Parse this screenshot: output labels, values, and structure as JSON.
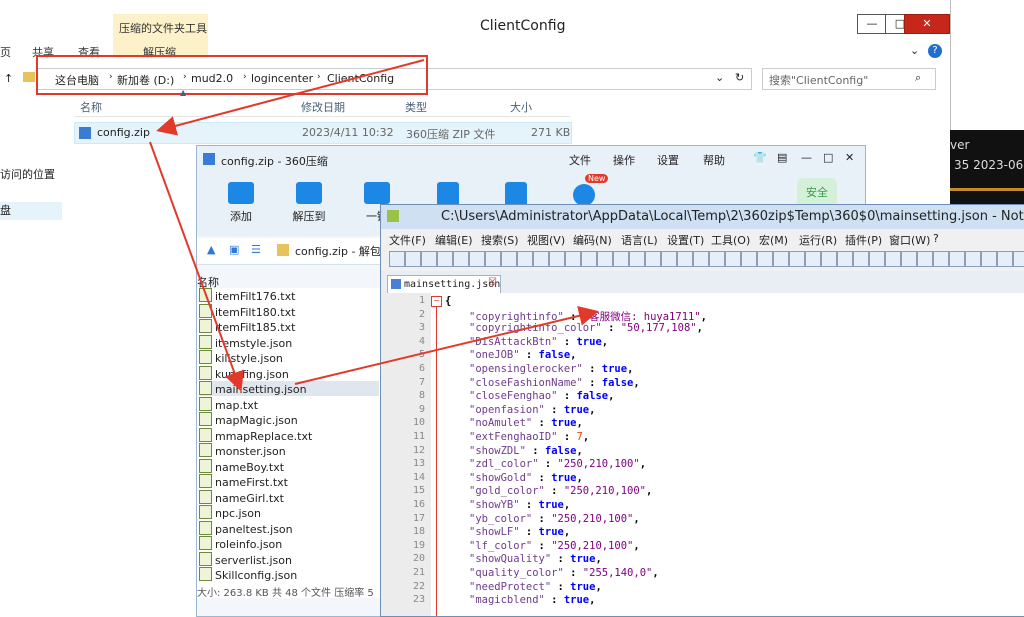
{
  "explorer": {
    "title": "ClientConfig",
    "ribbon_context_tab": "压缩的文件夹工具",
    "ribbon_tabs": [
      "页",
      "共享",
      "查看",
      "解压缩"
    ],
    "breadcrumb": [
      "这台电脑",
      "新加卷 (D:)",
      "mud2.0",
      "logincenter",
      "ClientConfig"
    ],
    "search_placeholder": "搜索\"ClientConfig\"",
    "columns": [
      "名称",
      "修改日期",
      "类型",
      "大小"
    ],
    "file": {
      "name": "config.zip",
      "date": "2023/4/11 10:32",
      "type": "360压缩 ZIP 文件",
      "size": "271 KB"
    },
    "nav_items": [
      "访问的位置",
      "盘"
    ]
  },
  "zip": {
    "title": "config.zip - 360压缩",
    "menu": [
      "文件",
      "操作",
      "设置",
      "帮助"
    ],
    "tools": [
      "添加",
      "解压到",
      "一键"
    ],
    "badge": "New",
    "security": "安全",
    "path": "config.zip - 解包",
    "list_header": "名称",
    "files": [
      "itemFilt176.txt",
      "itemFilt180.txt",
      "itemFilt185.txt",
      "itemstyle.json",
      "killstyle.json",
      "kungfing.json",
      "mainsetting.json",
      "map.txt",
      "mapMagic.json",
      "mmapReplace.txt",
      "monster.json",
      "nameBoy.txt",
      "nameFirst.txt",
      "nameGirl.txt",
      "npc.json",
      "paneltest.json",
      "roleinfo.json",
      "serverlist.json",
      "Skillconfig.json"
    ],
    "status": "大小: 263.8 KB 共 48 个文件 压缩率 5"
  },
  "notepad": {
    "title": "C:\\Users\\Administrator\\AppData\\Local\\Temp\\2\\360zip$Temp\\360$0\\mainsetting.json - Notep",
    "menu": [
      "文件(F)",
      "编辑(E)",
      "搜索(S)",
      "视图(V)",
      "编码(N)",
      "语言(L)",
      "设置(T)",
      "工具(O)",
      "宏(M)",
      "运行(R)",
      "插件(P)",
      "窗口(W)",
      "?"
    ],
    "tab": "mainsetting.json",
    "lines": [
      {
        "n": "1",
        "parts": [
          [
            "p",
            "{"
          ]
        ]
      },
      {
        "n": "2",
        "parts": [
          [
            "k",
            "\"copyrightinfo\""
          ],
          [
            "p",
            " : "
          ],
          [
            "s",
            "\"客服微信: huya1711\""
          ],
          [
            "p",
            ","
          ]
        ]
      },
      {
        "n": "3",
        "parts": [
          [
            "k",
            "\"copyrightinfo_color\""
          ],
          [
            "p",
            " : "
          ],
          [
            "s",
            "\"50,177,108\""
          ],
          [
            "p",
            ","
          ]
        ]
      },
      {
        "n": "4",
        "parts": [
          [
            "k",
            "\"DisAttackBtn\""
          ],
          [
            "p",
            " : "
          ],
          [
            "bt",
            "true"
          ],
          [
            "p",
            ","
          ]
        ]
      },
      {
        "n": "5",
        "parts": [
          [
            "k",
            "\"oneJOB\""
          ],
          [
            "p",
            " : "
          ],
          [
            "bt",
            "false"
          ],
          [
            "p",
            ","
          ]
        ]
      },
      {
        "n": "6",
        "parts": [
          [
            "k",
            "\"opensinglerocker\""
          ],
          [
            "p",
            " : "
          ],
          [
            "bt",
            "true"
          ],
          [
            "p",
            ","
          ]
        ]
      },
      {
        "n": "7",
        "parts": [
          [
            "k",
            "\"closeFashionName\""
          ],
          [
            "p",
            " : "
          ],
          [
            "bt",
            "false"
          ],
          [
            "p",
            ","
          ]
        ]
      },
      {
        "n": "8",
        "parts": [
          [
            "k",
            "\"closeFenghao\""
          ],
          [
            "p",
            " : "
          ],
          [
            "bt",
            "false"
          ],
          [
            "p",
            ","
          ]
        ]
      },
      {
        "n": "9",
        "parts": [
          [
            "k",
            "\"openfasion\""
          ],
          [
            "p",
            " : "
          ],
          [
            "bt",
            "true"
          ],
          [
            "p",
            ","
          ]
        ]
      },
      {
        "n": "10",
        "parts": [
          [
            "k",
            "\"noAmulet\""
          ],
          [
            "p",
            " : "
          ],
          [
            "bt",
            "true"
          ],
          [
            "p",
            ","
          ]
        ]
      },
      {
        "n": "11",
        "parts": [
          [
            "k",
            "\"extFenghaoID\""
          ],
          [
            "p",
            " : "
          ],
          [
            "n",
            "7"
          ],
          [
            "p",
            ","
          ]
        ]
      },
      {
        "n": "12",
        "parts": [
          [
            "k",
            "\"showZDL\""
          ],
          [
            "p",
            " : "
          ],
          [
            "bt",
            "false"
          ],
          [
            "p",
            ","
          ]
        ]
      },
      {
        "n": "13",
        "parts": [
          [
            "k",
            "\"zdl_color\""
          ],
          [
            "p",
            " : "
          ],
          [
            "s",
            "\"250,210,100\""
          ],
          [
            "p",
            ","
          ]
        ]
      },
      {
        "n": "14",
        "parts": [
          [
            "k",
            "\"showGold\""
          ],
          [
            "p",
            " : "
          ],
          [
            "bt",
            "true"
          ],
          [
            "p",
            ","
          ]
        ]
      },
      {
        "n": "15",
        "parts": [
          [
            "k",
            "\"gold_color\""
          ],
          [
            "p",
            " : "
          ],
          [
            "s",
            "\"250,210,100\""
          ],
          [
            "p",
            ","
          ]
        ]
      },
      {
        "n": "16",
        "parts": [
          [
            "k",
            "\"showYB\""
          ],
          [
            "p",
            " : "
          ],
          [
            "bt",
            "true"
          ],
          [
            "p",
            ","
          ]
        ]
      },
      {
        "n": "17",
        "parts": [
          [
            "k",
            "\"yb_color\""
          ],
          [
            "p",
            " : "
          ],
          [
            "s",
            "\"250,210,100\""
          ],
          [
            "p",
            ","
          ]
        ]
      },
      {
        "n": "18",
        "parts": [
          [
            "k",
            "\"showLF\""
          ],
          [
            "p",
            " : "
          ],
          [
            "bt",
            "true"
          ],
          [
            "p",
            ","
          ]
        ]
      },
      {
        "n": "19",
        "parts": [
          [
            "k",
            "\"lf_color\""
          ],
          [
            "p",
            " : "
          ],
          [
            "s",
            "\"250,210,100\""
          ],
          [
            "p",
            ","
          ]
        ]
      },
      {
        "n": "20",
        "parts": [
          [
            "k",
            "\"showQuality\""
          ],
          [
            "p",
            " : "
          ],
          [
            "bt",
            "true"
          ],
          [
            "p",
            ","
          ]
        ]
      },
      {
        "n": "21",
        "parts": [
          [
            "k",
            "\"quality_color\""
          ],
          [
            "p",
            " : "
          ],
          [
            "s",
            "\"255,140,0\""
          ],
          [
            "p",
            ","
          ]
        ]
      },
      {
        "n": "22",
        "parts": [
          [
            "k",
            "\"needProtect\""
          ],
          [
            "p",
            " : "
          ],
          [
            "bt",
            "true"
          ],
          [
            "p",
            ","
          ]
        ]
      },
      {
        "n": "23",
        "parts": [
          [
            "k",
            "\"magicblend\""
          ],
          [
            "p",
            " : "
          ],
          [
            "bt",
            "true"
          ],
          [
            "p",
            ","
          ]
        ]
      }
    ]
  },
  "background_window": {
    "line1": "ver",
    "line2": "35 2023-06"
  },
  "colors": {
    "highlight": "#e23a2a",
    "arrow": "#e23a2a",
    "close": "#c7261b"
  }
}
